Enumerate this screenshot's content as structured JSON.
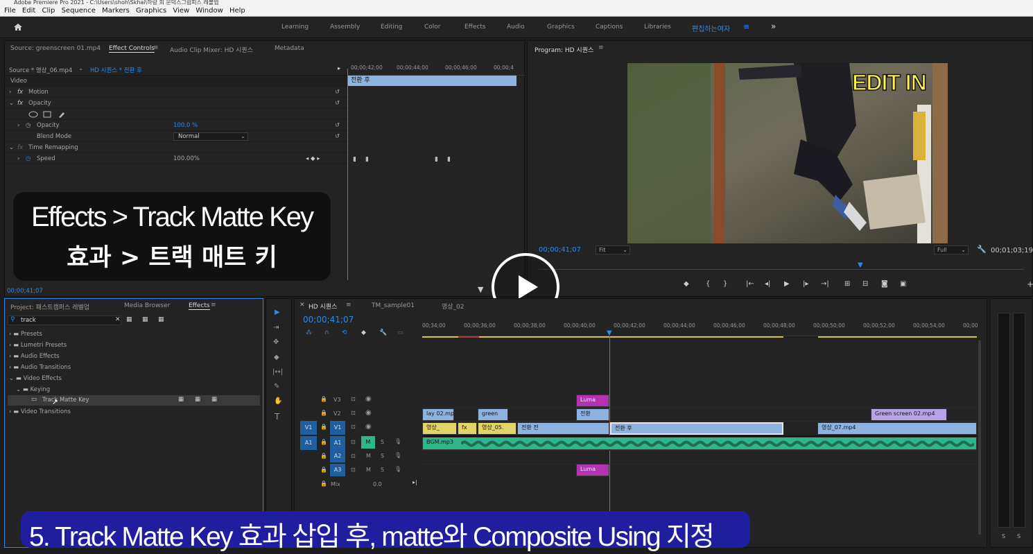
{
  "window": {
    "title": "Adobe Premiere Pro 2021 - C:\\Users\\shoh\\Skhai\\하랑 희 문덕스그럼피스 레볼업"
  },
  "menu": [
    "File",
    "Edit",
    "Clip",
    "Sequence",
    "Markers",
    "Graphics",
    "View",
    "Window",
    "Help"
  ],
  "workspaces": [
    "Learning",
    "Assembly",
    "Editing",
    "Color",
    "Effects",
    "Audio",
    "Graphics",
    "Captions",
    "Libraries",
    "편집하는여자",
    "≡",
    "»"
  ],
  "source_panel": {
    "tabs": [
      "Source: greenscreen 01.mp4",
      "Effect Controls",
      "Audio Clip Mixer: HD 시퀀스",
      "Metadata"
    ],
    "source_label": "Source * 영상_06.mp4",
    "sequence_label": "HD 시퀀스 * 전환 후",
    "clip_name": "전환 후",
    "ruler": [
      "00;00;42;00",
      "00;00;44;00",
      "00;00;46;00",
      "00;00;4"
    ],
    "rows": {
      "video": "Video",
      "motion": "Motion",
      "opacity": "Opacity",
      "opacity_prop": "Opacity",
      "opacity_val": "100.0 %",
      "blend": "Blend Mode",
      "blend_val": "Normal",
      "time_remap": "Time Remapping",
      "speed": "Speed",
      "speed_val": "100.00%"
    },
    "timecode": "00;00;41;07"
  },
  "program": {
    "title": "Program: HD 시퀀스",
    "overlay": "EDIT IN",
    "timecode": "00;00;41;07",
    "fit": "Fit",
    "quality": "Full",
    "duration": "00;01;03;19"
  },
  "caption1": {
    "line1": "Effects > Track Matte Key",
    "line2": "효과 > 트랙 매트 키"
  },
  "project": {
    "tabs": [
      "Project: 패스트캠퍼스 레벨업",
      "Media Browser",
      "Effects"
    ],
    "search": "track",
    "tree": [
      "Presets",
      "Lumetri Presets",
      "Audio Effects",
      "Audio Transitions",
      "Video Effects",
      "Keying",
      "Track Matte Key",
      "Video Transitions"
    ]
  },
  "timeline": {
    "tabs": [
      "HD 시퀀스",
      "TM_sample01",
      "영상_02"
    ],
    "timecode": "00;00;41;07",
    "ruler": [
      "00;34;00",
      "00;00;36;00",
      "00;00;38;00",
      "00;00;40;00",
      "00;00;42;00",
      "00;00;44;00",
      "00;00;46;00",
      "00;00;48;00",
      "00;00;50;00",
      "00;00;52;00",
      "00;00;54;00",
      "00;00"
    ],
    "tracks": [
      "V3",
      "V2",
      "V1",
      "A1",
      "A2",
      "A3",
      "Mix"
    ],
    "src": [
      "V1",
      "A1"
    ],
    "mix_val": "0.0",
    "clips": {
      "luma": "Luma",
      "v2a": "lay 02.mp4",
      "v2b": "green",
      "v2c": "전환",
      "v2d": "Green screen 02.mp4",
      "v1a": "영상_",
      "v1b": "영상_05.",
      "v1c": "전환 전",
      "v1d": "전환 후",
      "v1e": "영상_07.mp4",
      "a1": "BGM.mp3",
      "fx": "fx"
    },
    "m": "M",
    "s": "S"
  },
  "caption2": "5. Track Matte Key 효과 삽입 후, matte와 Composite Using 지정",
  "colors": {
    "accent": "#2d8ceb",
    "clip_blue": "#8fb3e0",
    "clip_yellow": "#e3d46a",
    "clip_magenta": "#b232b2",
    "clip_green": "#2fb58a"
  }
}
